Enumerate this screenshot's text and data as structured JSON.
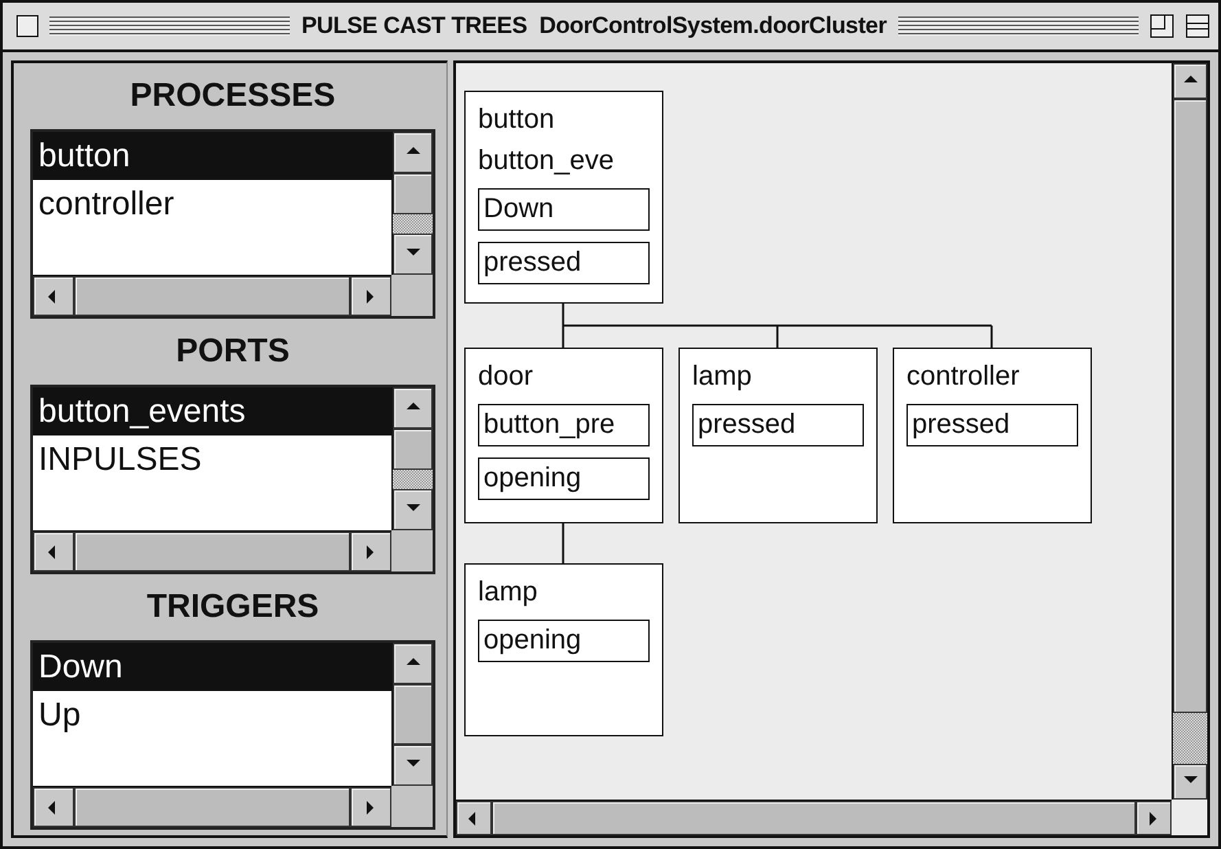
{
  "window": {
    "title": "PULSE CAST TREES  DoorControlSystem.doorCluster"
  },
  "panels": [
    {
      "title": "PROCESSES",
      "items": [
        {
          "label": "button",
          "selected": true
        },
        {
          "label": "controller",
          "selected": false
        }
      ]
    },
    {
      "title": "PORTS",
      "items": [
        {
          "label": "button_events",
          "selected": true
        },
        {
          "label": "INPULSES",
          "selected": false
        }
      ]
    },
    {
      "title": "TRIGGERS",
      "items": [
        {
          "label": "Down",
          "selected": true
        },
        {
          "label": "Up",
          "selected": false
        }
      ]
    }
  ],
  "tree": {
    "name": "button",
    "port": "button_eve",
    "fields": [
      "Down",
      "pressed"
    ],
    "children": [
      {
        "name": "door",
        "fields": [
          "button_pre",
          "opening"
        ],
        "children": [
          {
            "name": "lamp",
            "fields": [
              "opening"
            ]
          }
        ]
      },
      {
        "name": "lamp",
        "fields": [
          "pressed"
        ]
      },
      {
        "name": "controller",
        "fields": [
          "pressed"
        ]
      }
    ]
  }
}
